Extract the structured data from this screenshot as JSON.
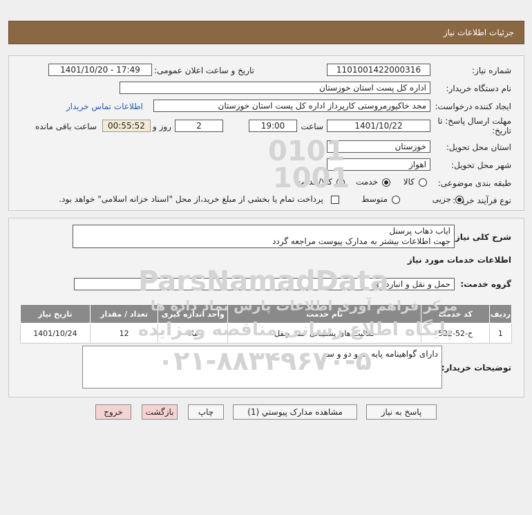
{
  "header": {
    "title": "جزئیات اطلاعات نیاز"
  },
  "fields": {
    "need_number_label": "شماره نیاز:",
    "need_number": "1101001422000316",
    "announce_label": "تاریخ و ساعت اعلان عمومی:",
    "announce_value": "1401/10/20 - 17:49",
    "buyer_org_label": "نام دستگاه خریدار:",
    "buyer_org": "اداره کل پست استان خوزستان",
    "requester_label": "ایجاد کننده درخواست:",
    "requester": "مجد خاکپورمروستی کارپرداز اداره کل پست استان خوزستان",
    "contact_link": "اطلاعات تماس خریدار",
    "deadline_label_1": "مهلت ارسال پاسخ: تا",
    "deadline_label_2": "تاریخ:",
    "deadline_date": "1401/10/22",
    "time_label": "ساعت",
    "deadline_time": "19:00",
    "days_value": "2",
    "days_label": "روز و",
    "remaining_time": "00:55:52",
    "remaining_label": "ساعت باقی مانده",
    "province_label": "استان محل تحویل:",
    "province": "خوزستان",
    "city_label": "شهر محل تحویل:",
    "city": "اهواز",
    "category_label": "طبقه بندی موضوعی:",
    "category_options": [
      "کالا",
      "خدمت",
      "کالا/خدمت"
    ],
    "category_selected": "خدمت",
    "process_label": "نوع فرآیند خرید :",
    "process_options": [
      "جزیی",
      "متوسط"
    ],
    "process_selected": "جزیی",
    "treasury_note": "پرداخت تمام یا بخشی از مبلغ خرید،از محل \"اسناد خزانه اسلامی\" خواهد بود."
  },
  "details": {
    "general_label": "شرح کلی نیاز:",
    "general_line_1": "ایاب ذهاب پرسنل",
    "general_line_2": "جهت اطلاعات بیشتر به مدارک پیوست مراجعه گردد",
    "services_title": "اطلاعات خدمات مورد نیاز",
    "service_group_label": "گروه خدمت:",
    "service_group": "حمل و نقل و انبارداری",
    "table_headers": [
      "ردیف",
      "کد خدمت",
      "نام خدمت",
      "واحد اندازه گیری",
      "تعداد / مقدار",
      "تاریخ نیاز"
    ],
    "table_rows": [
      [
        "1",
        "ح-52-522",
        "فعالیت های پشتیبانی حمل ونقل",
        "ماه",
        "12",
        "1401/10/24"
      ]
    ],
    "buyer_notes_label": "توضیحات خریدار:",
    "buyer_notes": "دارای گواهینامه پایه یم و دو و سه"
  },
  "buttons": {
    "respond": "پاسخ به نیاز",
    "view_docs": "مشاهده مدارک پیوستي (1)",
    "print": "چاپ",
    "back": "بازگشت",
    "exit": "خروج"
  },
  "watermark": {
    "binary_1": "0101",
    "binary_2": "1001",
    "brand": "ParsNamadData",
    "center_line": "مرکز فراهم آوری اطلاعات پارس نماد داده ها",
    "tender_line": "پایگاه اطلاع رسانی مناقصه ومزایده",
    "phone": "۰۲۱-۸۸۳۴۹۶۷۰-۵"
  },
  "colors": {
    "header_bg": "#8b6844",
    "table_header_bg": "#8a8a8a",
    "link": "#1f5bb5",
    "pink_button": "#f6d3d3"
  }
}
